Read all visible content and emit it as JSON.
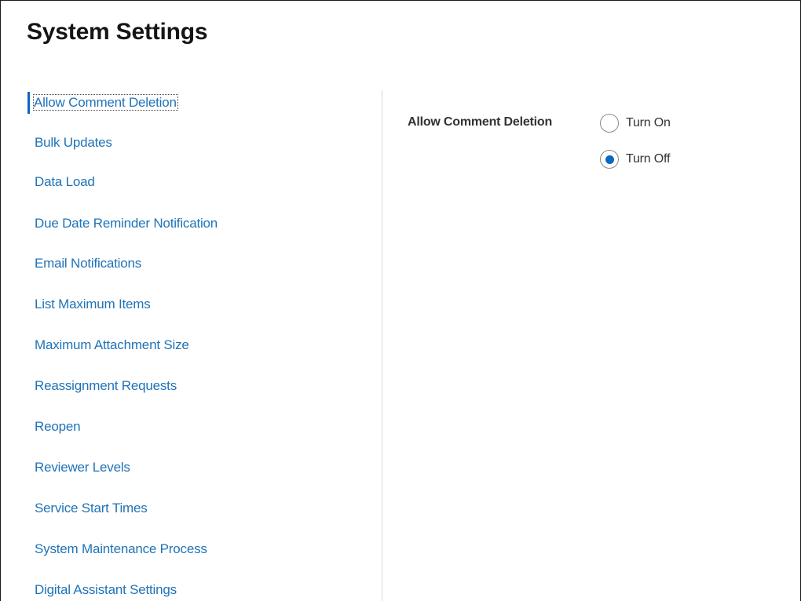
{
  "page": {
    "title": "System Settings"
  },
  "sidebar": {
    "items": [
      {
        "label": "Allow Comment Deletion",
        "selected": true
      },
      {
        "label": "Bulk Updates",
        "selected": false
      },
      {
        "label": "Data Load",
        "selected": false
      },
      {
        "label": "Due Date Reminder Notification",
        "selected": false
      },
      {
        "label": "Email Notifications",
        "selected": false
      },
      {
        "label": "List Maximum Items",
        "selected": false
      },
      {
        "label": "Maximum Attachment Size",
        "selected": false
      },
      {
        "label": "Reassignment Requests",
        "selected": false
      },
      {
        "label": "Reopen",
        "selected": false
      },
      {
        "label": "Reviewer Levels",
        "selected": false
      },
      {
        "label": "Service Start Times",
        "selected": false
      },
      {
        "label": "System Maintenance Process",
        "selected": false
      },
      {
        "label": "Digital Assistant Settings",
        "selected": false
      }
    ]
  },
  "setting": {
    "label": "Allow Comment Deletion",
    "options": [
      {
        "label": "Turn On",
        "checked": false
      },
      {
        "label": "Turn Off",
        "checked": true
      }
    ]
  },
  "colors": {
    "link": "#1f73b7",
    "accent": "#0a67c2",
    "divider": "#d9d9d9",
    "text": "#333333"
  }
}
